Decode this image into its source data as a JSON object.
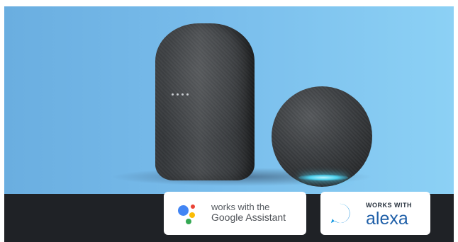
{
  "google_badge": {
    "line1": "works with the",
    "line2": "Google Assistant",
    "icon": "google-assistant-icon"
  },
  "alexa_badge": {
    "small_label": "WORKS WITH",
    "word": "alexa",
    "icon": "alexa-ring-icon"
  },
  "colors": {
    "background_blue": "#78bceb",
    "bottom_bar": "#1f2226",
    "echo_light": "#4fd2ef",
    "alexa_blue": "#1f5fa8"
  }
}
